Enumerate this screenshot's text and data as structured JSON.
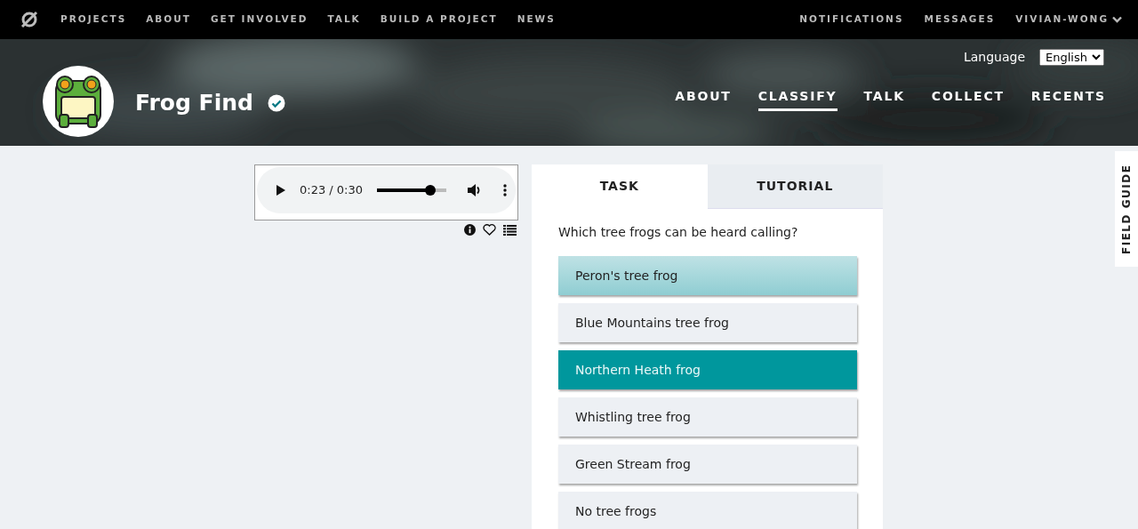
{
  "top_nav": {
    "items": [
      {
        "label": "PROJECTS"
      },
      {
        "label": "ABOUT"
      },
      {
        "label": "GET INVOLVED"
      },
      {
        "label": "TALK"
      },
      {
        "label": "BUILD A PROJECT"
      },
      {
        "label": "NEWS"
      }
    ],
    "right_items": [
      {
        "label": "NOTIFICATIONS"
      },
      {
        "label": "MESSAGES"
      }
    ],
    "user": "VIVIAN-WONG"
  },
  "project": {
    "title": "Frog Find",
    "verified": true,
    "language_label": "Language",
    "language": "English",
    "nav": [
      {
        "label": "ABOUT",
        "selected": false
      },
      {
        "label": "CLASSIFY",
        "selected": true
      },
      {
        "label": "TALK",
        "selected": false
      },
      {
        "label": "COLLECT",
        "selected": false
      },
      {
        "label": "RECENTS",
        "selected": false
      }
    ]
  },
  "audio": {
    "time": "0:23 / 0:30",
    "level": 0.77
  },
  "tabs": [
    {
      "label": "TASK",
      "selected": true
    },
    {
      "label": "TUTORIAL",
      "selected": false
    }
  ],
  "question": "Which tree frogs can be heard calling?",
  "answers": [
    {
      "label": "Peron's tree frog",
      "selected": false,
      "hovered": true
    },
    {
      "label": "Blue Mountains tree frog",
      "selected": false,
      "hovered": false
    },
    {
      "label": "Northern Heath frog",
      "selected": true,
      "hovered": false
    },
    {
      "label": "Whistling tree frog",
      "selected": false,
      "hovered": false
    },
    {
      "label": "Green Stream frog",
      "selected": false,
      "hovered": false
    },
    {
      "label": "No tree frogs",
      "selected": false,
      "hovered": false
    }
  ],
  "field_guide": "FIELD GUIDE"
}
